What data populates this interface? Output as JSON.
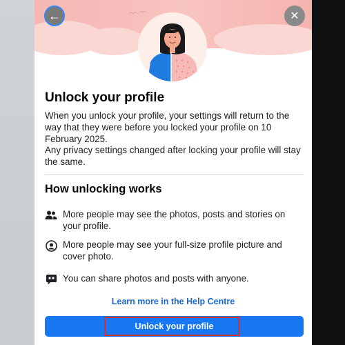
{
  "dialog": {
    "title": "Unlock your profile",
    "description_line1": "When you unlock your profile, your settings will return to the way that they were before you locked your profile on 10 February 2025.",
    "description_line2": "Any privacy settings changed after locking your profile will stay the same.",
    "subtitle": "How unlocking works",
    "items": [
      {
        "icon": "people-icon",
        "text": "More people may see the photos, posts and stories on your profile."
      },
      {
        "icon": "user-circle-icon",
        "text": "More people may see your full-size profile picture and cover photo."
      },
      {
        "icon": "share-chat-icon",
        "text": "You can share photos and posts with anyone."
      }
    ],
    "help_link": "Learn more in the Help Centre",
    "primary_button": "Unlock your profile",
    "back_icon": "←",
    "close_icon": "✕"
  },
  "colors": {
    "accent": "#1877f2",
    "link": "#1b66c9",
    "highlight": "#d8302f",
    "hero_bg": "#f6b7b4"
  }
}
